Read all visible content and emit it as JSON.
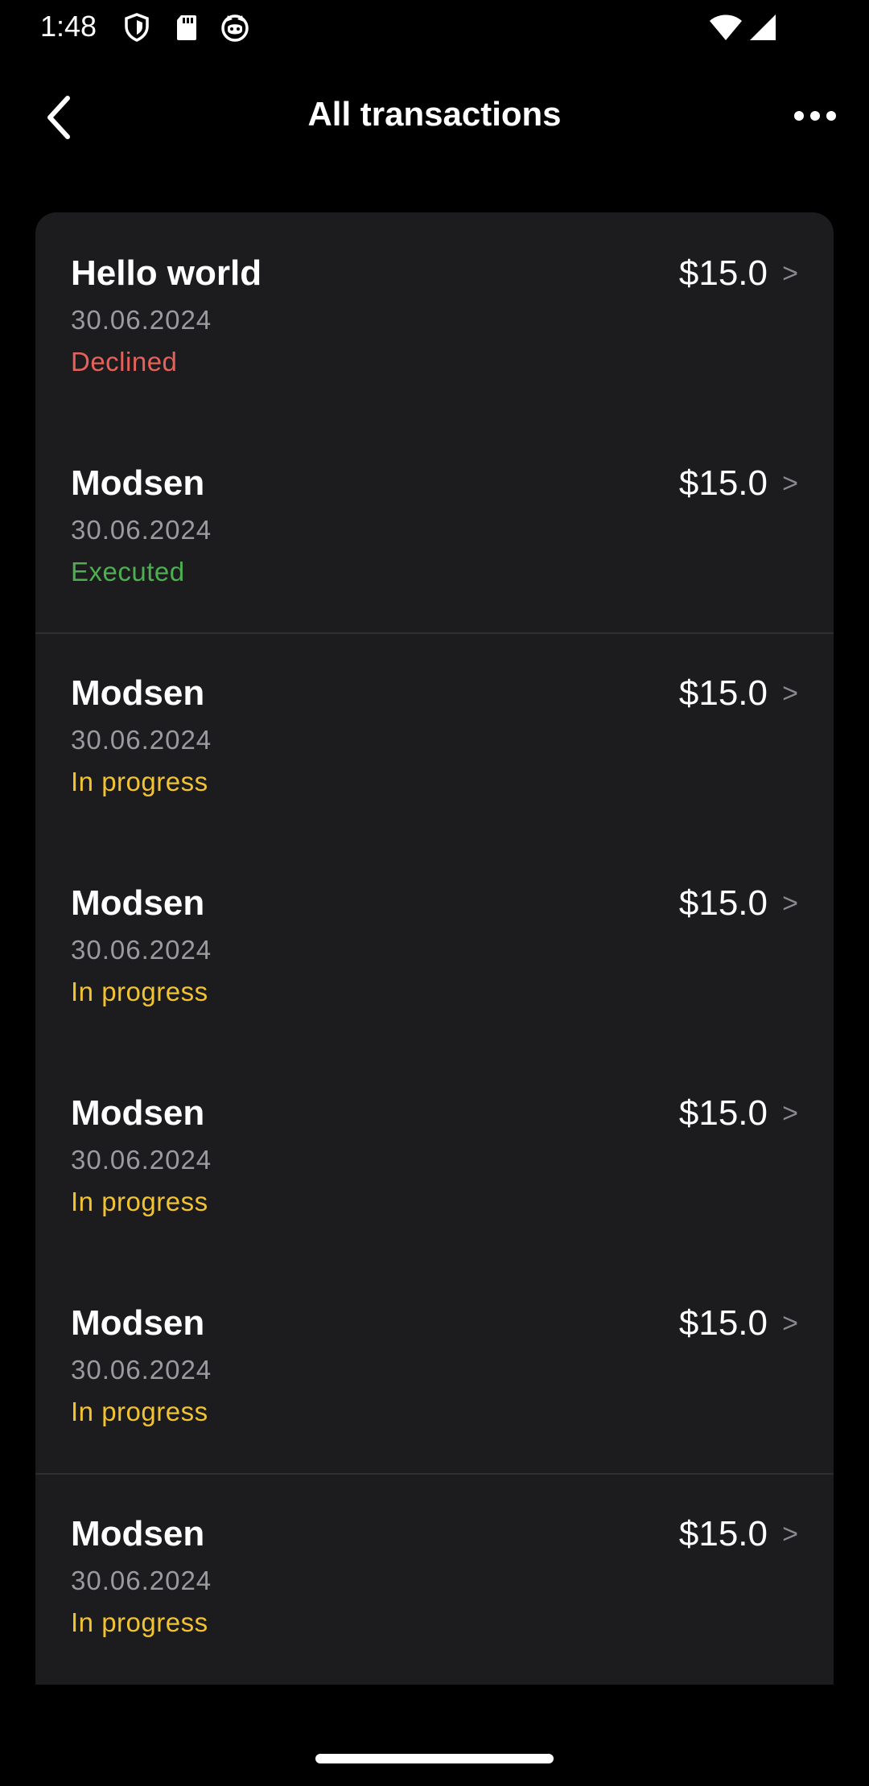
{
  "status_bar": {
    "time": "1:48",
    "icons": [
      "shield-icon",
      "sd-card-icon",
      "cat-face-icon",
      "wifi-icon",
      "signal-icon"
    ]
  },
  "app_bar": {
    "title": "All transactions",
    "back_icon": "chevron-left-icon",
    "more_icon": "more-horizontal-icon"
  },
  "colors": {
    "background": "#000000",
    "card": "#1c1c1e",
    "declined": "#e5625a",
    "executed": "#4caf50",
    "in_progress": "#f1c232",
    "secondary_text": "#9a9a9f"
  },
  "transactions": [
    {
      "name": "Hello world",
      "date": "30.06.2024",
      "status": "Declined",
      "status_kind": "declined",
      "amount": "$15.0",
      "chevron": ">"
    },
    {
      "name": "Modsen",
      "date": "30.06.2024",
      "status": "Executed",
      "status_kind": "executed",
      "amount": "$15.0",
      "chevron": ">"
    },
    {
      "name": "Modsen",
      "date": "30.06.2024",
      "status": "In progress",
      "status_kind": "in_progress",
      "amount": "$15.0",
      "chevron": ">"
    },
    {
      "name": "Modsen",
      "date": "30.06.2024",
      "status": "In progress",
      "status_kind": "in_progress",
      "amount": "$15.0",
      "chevron": ">"
    },
    {
      "name": "Modsen",
      "date": "30.06.2024",
      "status": "In progress",
      "status_kind": "in_progress",
      "amount": "$15.0",
      "chevron": ">"
    },
    {
      "name": "Modsen",
      "date": "30.06.2024",
      "status": "In progress",
      "status_kind": "in_progress",
      "amount": "$15.0",
      "chevron": ">"
    },
    {
      "name": "Modsen",
      "date": "30.06.2024",
      "status": "In progress",
      "status_kind": "in_progress",
      "amount": "$15.0",
      "chevron": ">"
    }
  ]
}
